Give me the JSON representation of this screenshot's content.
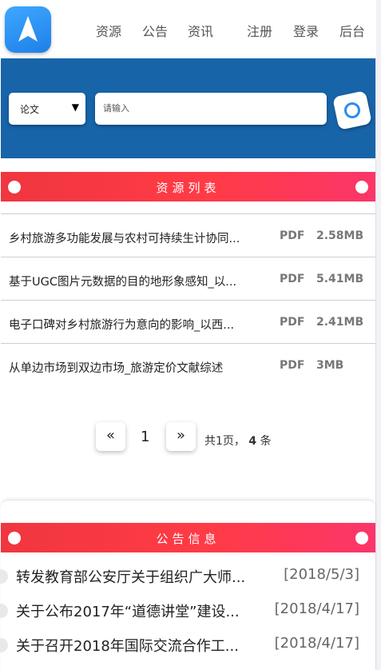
{
  "nav": {
    "links": [
      "资源",
      "公告",
      "资讯",
      "注册",
      "登录",
      "后台"
    ]
  },
  "search": {
    "category": "论文",
    "placeholder": "请输入",
    "button_icon": "search-circle-icon"
  },
  "resources": {
    "section_title": "资源列表",
    "items": [
      {
        "name": "乡村旅游多功能发展与农村可持续生计协同...",
        "type": "PDF",
        "size": "2.58MB"
      },
      {
        "name": "基于UGC图片元数据的目的地形象感知_以...",
        "type": "PDF",
        "size": "5.41MB"
      },
      {
        "name": "电子口碑对乡村旅游行为意向的影响_以西...",
        "type": "PDF",
        "size": "2.41MB"
      },
      {
        "name": "从单边市场到双边市场_旅游定价文献综述",
        "type": "PDF",
        "size": "3MB"
      }
    ]
  },
  "pagination": {
    "prev": "«",
    "current_page": "1",
    "next": "»",
    "info_prefix": "共",
    "total_pages": "1",
    "info_mid": "页，",
    "total_items": "4",
    "info_suffix": "条"
  },
  "notices": {
    "section_title": "公告信息",
    "items": [
      {
        "title": "转发教育部公安厅关于组织广大师...",
        "date": "[2018/5/3]"
      },
      {
        "title": "关于公布2017年“道德讲堂”建设...",
        "date": "[2018/4/17]"
      },
      {
        "title": "关于召开2018年国际交流合作工...",
        "date": "[2018/4/17]"
      }
    ]
  },
  "colors": {
    "brand_blue": "#1864a9",
    "accent_red": "#ff3b46",
    "logo_blue": "#2d8cf0"
  }
}
